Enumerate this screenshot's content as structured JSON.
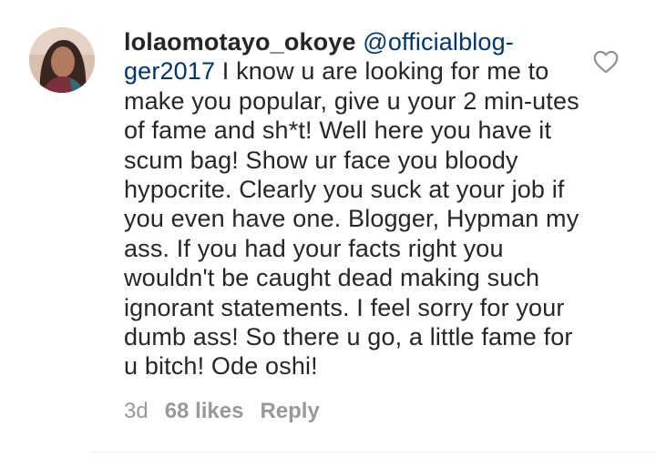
{
  "comment": {
    "username": "lolaomotayo_okoye",
    "mention": "@officialblog-ger2017",
    "text": "I know u are looking for me to make you popular, give u your 2 min-utes of fame and sh*t! Well here you have it scum bag! Show ur face you bloody hypocrite. Clearly you suck at your job if you even have one. Blogger, Hypman my ass. If you had your facts right you wouldn't be caught dead making such ignorant statements. I feel sorry for your dumb ass! So there u go, a little fame for u bitch! Ode oshi!",
    "time": "3d",
    "likes": "68 likes",
    "reply_label": "Reply"
  },
  "icons": {
    "like": "heart-outline-icon",
    "avatar": "profile-avatar"
  },
  "colors": {
    "text": "#262626",
    "mention": "#003569",
    "meta": "#999999",
    "divider": "#efefef"
  }
}
